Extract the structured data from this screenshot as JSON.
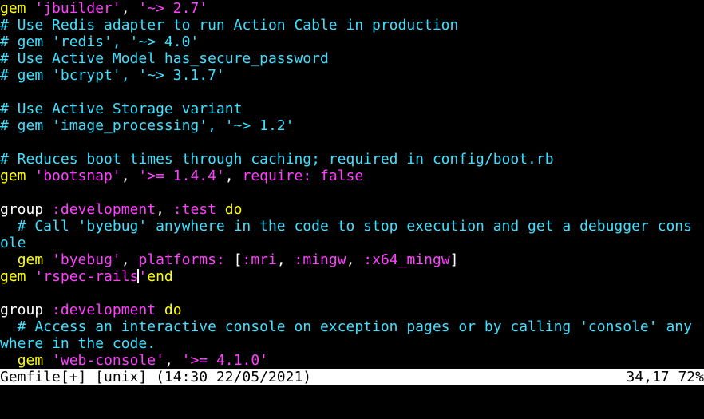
{
  "colors": {
    "background": "#000000",
    "text": "#ffffff",
    "string": "#ff40ff",
    "comment": "#3fe0ff",
    "keyword": "#ffff00",
    "symbol": "#ff40ff",
    "statusbar_bg": "#ffffff",
    "statusbar_fg": "#000000"
  },
  "editor": {
    "lines": [
      {
        "tokens": [
          {
            "t": "gem",
            "c": "keyword"
          },
          {
            "t": " "
          },
          {
            "t": "'jbuilder'",
            "c": "string"
          },
          {
            "t": ", "
          },
          {
            "t": "'~> 2.7'",
            "c": "string"
          }
        ]
      },
      {
        "tokens": [
          {
            "t": "# Use Redis adapter to run Action Cable in production",
            "c": "comment"
          }
        ]
      },
      {
        "tokens": [
          {
            "t": "# gem 'redis', '~> 4.0'",
            "c": "comment"
          }
        ]
      },
      {
        "tokens": [
          {
            "t": "# Use Active Model has_secure_password",
            "c": "comment"
          }
        ]
      },
      {
        "tokens": [
          {
            "t": "# gem 'bcrypt', '~> 3.1.7'",
            "c": "comment"
          }
        ]
      },
      {
        "tokens": []
      },
      {
        "tokens": [
          {
            "t": "# Use Active Storage variant",
            "c": "comment"
          }
        ]
      },
      {
        "tokens": [
          {
            "t": "# gem 'image_processing', '~> 1.2'",
            "c": "comment"
          }
        ]
      },
      {
        "tokens": []
      },
      {
        "tokens": [
          {
            "t": "# Reduces boot times through caching; required in config/boot.rb",
            "c": "comment"
          }
        ]
      },
      {
        "tokens": [
          {
            "t": "gem",
            "c": "keyword"
          },
          {
            "t": " "
          },
          {
            "t": "'bootsnap'",
            "c": "string"
          },
          {
            "t": ", "
          },
          {
            "t": "'>= 1.4.4'",
            "c": "string"
          },
          {
            "t": ", "
          },
          {
            "t": "require:",
            "c": "symbol"
          },
          {
            "t": " "
          },
          {
            "t": "false",
            "c": "string"
          }
        ]
      },
      {
        "tokens": []
      },
      {
        "tokens": [
          {
            "t": "group "
          },
          {
            "t": ":development",
            "c": "symbol"
          },
          {
            "t": ", "
          },
          {
            "t": ":test",
            "c": "symbol"
          },
          {
            "t": " "
          },
          {
            "t": "do",
            "c": "keyword"
          }
        ]
      },
      {
        "tokens": [
          {
            "t": "  # Call 'byebug' anywhere in the code to stop execution and get a debugger cons",
            "c": "comment"
          }
        ]
      },
      {
        "tokens": [
          {
            "t": "ole",
            "c": "comment"
          }
        ]
      },
      {
        "tokens": [
          {
            "t": "  "
          },
          {
            "t": "gem",
            "c": "keyword"
          },
          {
            "t": " "
          },
          {
            "t": "'byebug'",
            "c": "string"
          },
          {
            "t": ", "
          },
          {
            "t": "platforms:",
            "c": "symbol"
          },
          {
            "t": " ["
          },
          {
            "t": ":mri",
            "c": "symbol"
          },
          {
            "t": ", "
          },
          {
            "t": ":mingw",
            "c": "symbol"
          },
          {
            "t": ", "
          },
          {
            "t": ":x64_mingw",
            "c": "symbol"
          },
          {
            "t": "]"
          }
        ]
      },
      {
        "tokens": [
          {
            "t": "gem",
            "c": "keyword"
          },
          {
            "t": " "
          },
          {
            "t": "'rspec-rails",
            "c": "string"
          },
          {
            "t": "|CURSOR|"
          },
          {
            "t": "'",
            "c": "string"
          },
          {
            "t": "end",
            "c": "keyword"
          }
        ]
      },
      {
        "tokens": []
      },
      {
        "tokens": [
          {
            "t": "group "
          },
          {
            "t": ":development",
            "c": "symbol"
          },
          {
            "t": " "
          },
          {
            "t": "do",
            "c": "keyword"
          }
        ]
      },
      {
        "tokens": [
          {
            "t": "  # Access an interactive console on exception pages or by calling 'console' any",
            "c": "comment"
          }
        ]
      },
      {
        "tokens": [
          {
            "t": "where in the code.",
            "c": "comment"
          }
        ]
      },
      {
        "tokens": [
          {
            "t": "  "
          },
          {
            "t": "gem",
            "c": "keyword"
          },
          {
            "t": " "
          },
          {
            "t": "'web-console'",
            "c": "string"
          },
          {
            "t": ", "
          },
          {
            "t": "'>= 4.1.0'",
            "c": "string"
          }
        ]
      }
    ]
  },
  "statusbar": {
    "left": "Gemfile[+] [unix] (14:30 22/05/2021)",
    "right": "34,17 72%"
  }
}
